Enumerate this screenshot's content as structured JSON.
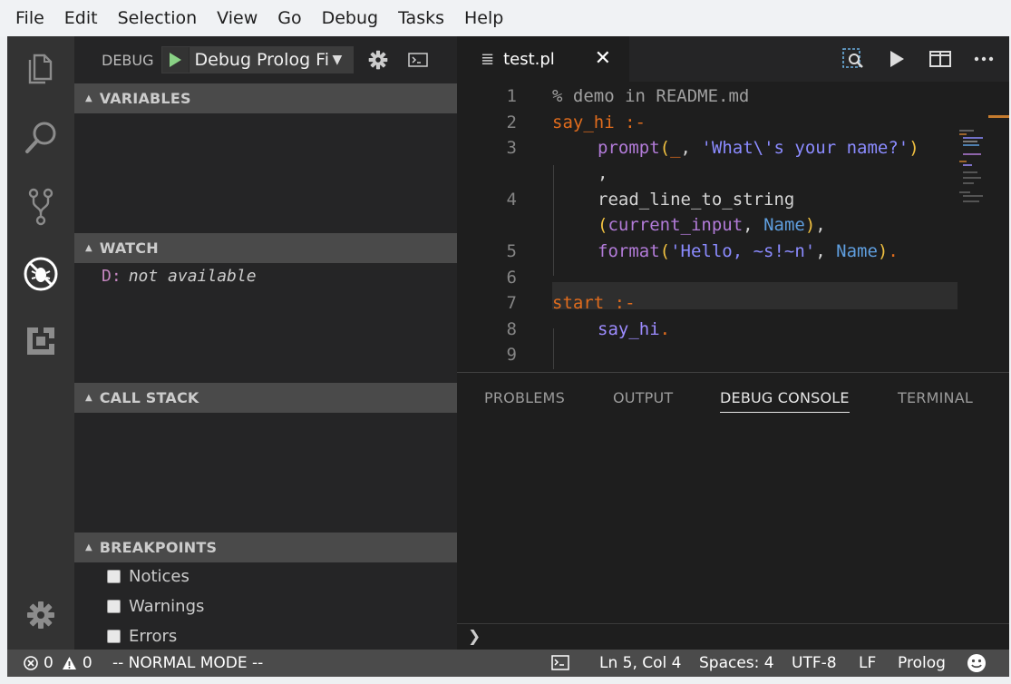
{
  "menubar": {
    "items": [
      "File",
      "Edit",
      "Selection",
      "View",
      "Go",
      "Debug",
      "Tasks",
      "Help"
    ]
  },
  "activitybar": {
    "icons": [
      "files-icon",
      "search-icon",
      "source-control-icon",
      "debug-icon",
      "extensions-icon",
      "gear-icon"
    ]
  },
  "sidebar": {
    "debug_label": "DEBUG",
    "config_name": "Debug Prolog Fi",
    "sections": {
      "variables": "VARIABLES",
      "watch": "WATCH",
      "call_stack": "CALL STACK",
      "breakpoints": "BREAKPOINTS"
    },
    "watch_items": [
      {
        "key": "D:",
        "value": "not available"
      }
    ],
    "breakpoints": [
      {
        "label": "Notices",
        "checked": false
      },
      {
        "label": "Warnings",
        "checked": false
      },
      {
        "label": "Errors",
        "checked": false
      }
    ]
  },
  "editor": {
    "tab_label": "test.pl",
    "close_glyph": "✕",
    "line_numbers": [
      "1",
      "2",
      "3",
      "",
      "4",
      "",
      "5",
      "6",
      "7",
      "8",
      "9"
    ],
    "code": {
      "l1": "% demo in README.md",
      "l2_head": "say_hi",
      "l2_op": " :-",
      "l3_fn": "prompt",
      "l3_p1": "(",
      "l3_var": "_",
      "l3_sep": ", ",
      "l3_str": "'What\\'s your name?'",
      "l3_p2": ")",
      "l3b": ",",
      "l4_fn": "read_line_to_string",
      "l4b_p1": "(",
      "l4b_a1": "current_input",
      "l4b_sep": ", ",
      "l4b_a2": "Name",
      "l4b_p2": ")",
      "l4b_end": ",",
      "l5_fn": "format",
      "l5_p1": "(",
      "l5_str": "'Hello, ~s!~n'",
      "l5_sep": ", ",
      "l5_var": "Name",
      "l5_p2": ")",
      "l5_dot": ".",
      "l7_head": "start",
      "l7_op": " :-",
      "l8_atom": "say_hi",
      "l8_dot": "."
    }
  },
  "panel": {
    "tabs": [
      "PROBLEMS",
      "OUTPUT",
      "DEBUG CONSOLE",
      "TERMINAL"
    ],
    "active_tab": "DEBUG CONSOLE",
    "prompt": "❯"
  },
  "statusbar": {
    "errors": "0",
    "warnings": "0",
    "mode": "-- NORMAL MODE  --",
    "position": "Ln 5, Col 4",
    "spaces": "Spaces: 4",
    "encoding": "UTF-8",
    "eol": "LF",
    "language": "Prolog"
  },
  "colors": {
    "accent_play": "#89d185",
    "activitybar": "#333333",
    "sidebar": "#252526",
    "editor": "#1e1e1e",
    "statusbar": "#4b4b4b"
  }
}
